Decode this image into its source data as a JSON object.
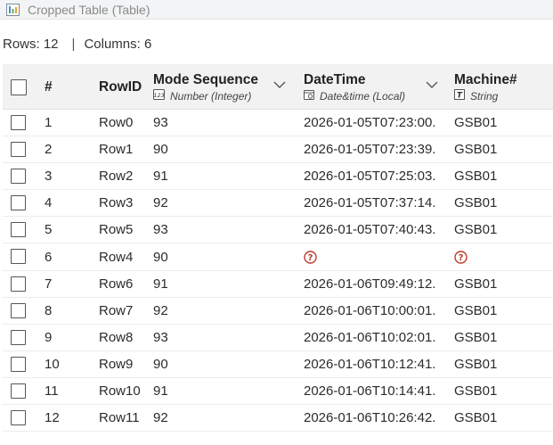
{
  "window": {
    "title": "Cropped Table (Table)"
  },
  "stats": {
    "rows_label": "Rows: 12",
    "separator": "|",
    "columns_label": "Columns: 6"
  },
  "columns": [
    {
      "key": "num",
      "name": "#"
    },
    {
      "key": "rowid",
      "name": "RowID"
    },
    {
      "key": "mode",
      "name": "Mode Sequence",
      "type": "Number (Integer)",
      "type_icon": "integer-type-icon"
    },
    {
      "key": "datetime",
      "name": "DateTime",
      "type": "Date&time (Local)",
      "type_icon": "datetime-type-icon"
    },
    {
      "key": "machine",
      "name": "Machine#",
      "type": "String",
      "type_icon": "string-type-icon"
    }
  ],
  "rows": [
    {
      "num": "1",
      "rowid": "Row0",
      "mode": "93",
      "datetime": "2026-01-05T07:23:00.",
      "machine": "GSB01"
    },
    {
      "num": "2",
      "rowid": "Row1",
      "mode": "90",
      "datetime": "2026-01-05T07:23:39.",
      "machine": "GSB01"
    },
    {
      "num": "3",
      "rowid": "Row2",
      "mode": "91",
      "datetime": "2026-01-05T07:25:03.",
      "machine": "GSB01"
    },
    {
      "num": "4",
      "rowid": "Row3",
      "mode": "92",
      "datetime": "2026-01-05T07:37:14.",
      "machine": "GSB01"
    },
    {
      "num": "5",
      "rowid": "Row5",
      "mode": "93",
      "datetime": "2026-01-05T07:40:43.",
      "machine": "GSB01"
    },
    {
      "num": "6",
      "rowid": "Row4",
      "mode": "90",
      "datetime": null,
      "machine": null
    },
    {
      "num": "7",
      "rowid": "Row6",
      "mode": "91",
      "datetime": "2026-01-06T09:49:12.",
      "machine": "GSB01"
    },
    {
      "num": "8",
      "rowid": "Row7",
      "mode": "92",
      "datetime": "2026-01-06T10:00:01.",
      "machine": "GSB01"
    },
    {
      "num": "9",
      "rowid": "Row8",
      "mode": "93",
      "datetime": "2026-01-06T10:02:01.",
      "machine": "GSB01"
    },
    {
      "num": "10",
      "rowid": "Row9",
      "mode": "90",
      "datetime": "2026-01-06T10:12:41.",
      "machine": "GSB01"
    },
    {
      "num": "11",
      "rowid": "Row10",
      "mode": "91",
      "datetime": "2026-01-06T10:14:41.",
      "machine": "GSB01"
    },
    {
      "num": "12",
      "rowid": "Row11",
      "mode": "92",
      "datetime": "2026-01-06T10:26:42.",
      "machine": "GSB01"
    }
  ],
  "colors": {
    "missing": "#c0392b",
    "header_bg": "#f2f2f2"
  }
}
